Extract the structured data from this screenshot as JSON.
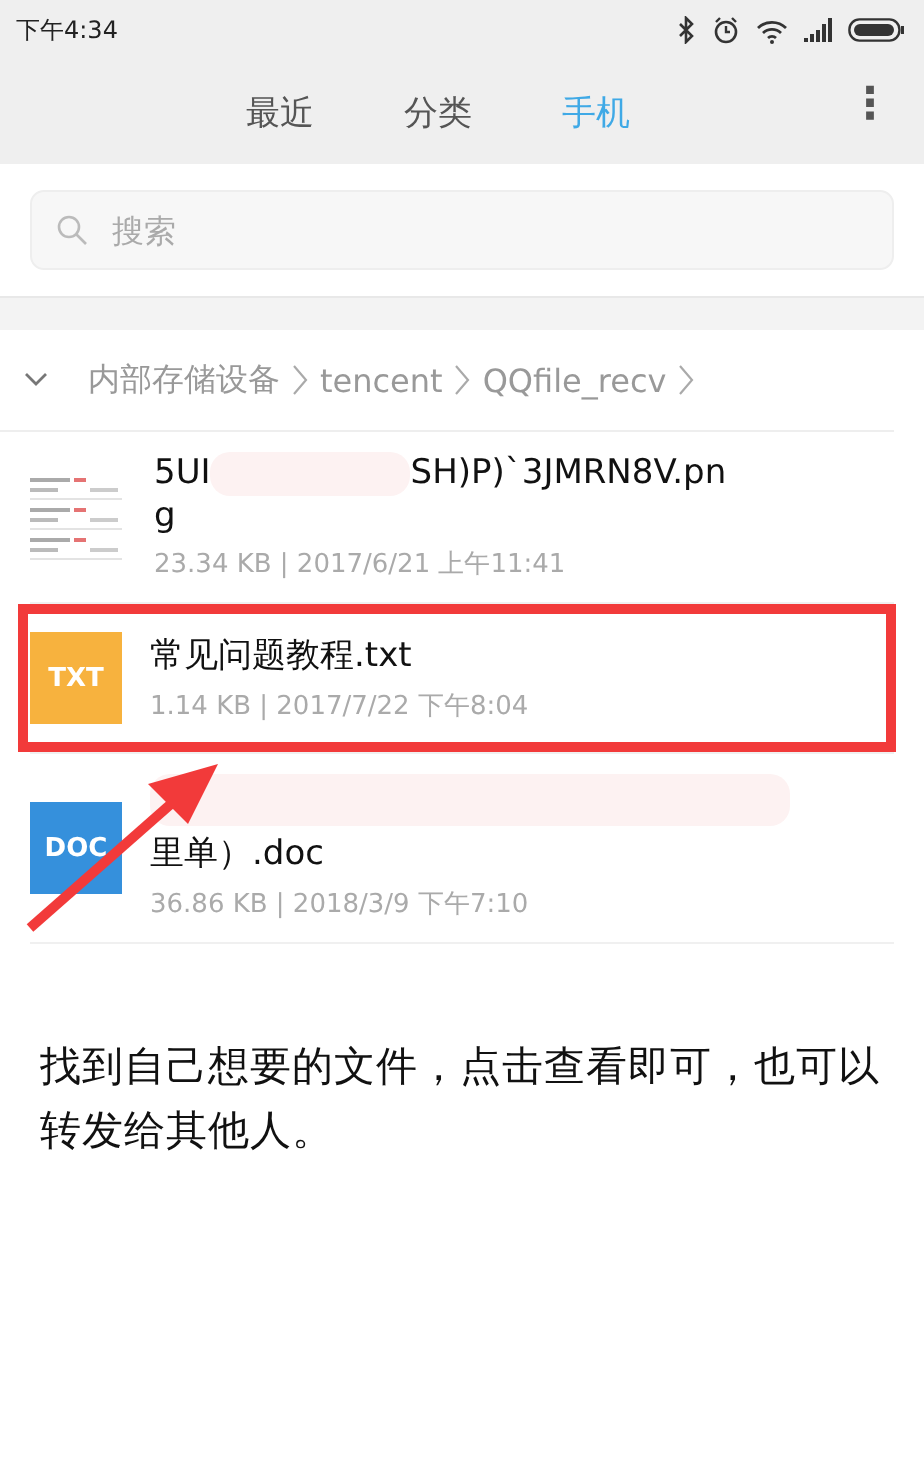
{
  "status_bar": {
    "time": "下午4:34"
  },
  "tabs": [
    {
      "label": "最近",
      "selected": false
    },
    {
      "label": "分类",
      "selected": false
    },
    {
      "label": "手机",
      "selected": true
    }
  ],
  "menu": "⋮",
  "search": {
    "placeholder": "搜索"
  },
  "breadcrumb": [
    "内部存储设备",
    "tencent",
    "QQfile_recv"
  ],
  "files": [
    {
      "kind": "image",
      "name_start": "5UI",
      "name_end": "SH)P)`3JMRN8V.pn",
      "name_cont": "g",
      "meta": "23.34 KB | 2017/6/21 上午11:41",
      "highlighted": false
    },
    {
      "kind": "txt",
      "badge": "TXT",
      "name_start": "常见问题教程.txt",
      "meta": "1.14 KB | 2017/7/22 下午8:04",
      "highlighted": true
    },
    {
      "kind": "doc",
      "badge": "DOC",
      "name_end": "里单）.doc",
      "meta": "36.86 KB | 2018/3/9 下午7:10",
      "highlighted": false
    }
  ],
  "caption": "找到自己想要的文件，点击查看即可，也可以转发给其他人。"
}
